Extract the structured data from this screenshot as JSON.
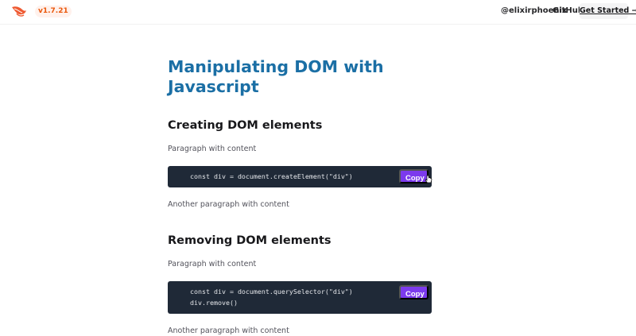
{
  "header": {
    "version": "v1.7.21",
    "twitter_label": "@elixirphoenix",
    "github_label": "GitHub",
    "get_started_label": "Get Started →"
  },
  "main": {
    "title": "Manipulating DOM with Javascript",
    "sections": [
      {
        "heading": "Creating DOM elements",
        "intro": "Paragraph with content",
        "code_lines": [
          "const div = document.createElement(\"div\")"
        ],
        "copy_label": "Copy",
        "outro": "Another paragraph with content"
      },
      {
        "heading": "Removing DOM elements",
        "intro": "Paragraph with content",
        "code_lines": [
          "const div = document.querySelector(\"div\")",
          "div.remove()"
        ],
        "copy_label": "Copy",
        "outro": "Another paragraph with content"
      }
    ]
  },
  "icons": {
    "logo": "phoenix-logo-icon",
    "cursor": "pointer-cursor-icon"
  },
  "colors": {
    "title": "#1b6fa5",
    "version_badge_text": "#ea580c",
    "code_background": "#1f2937",
    "copy_button": "#7c3aed"
  }
}
